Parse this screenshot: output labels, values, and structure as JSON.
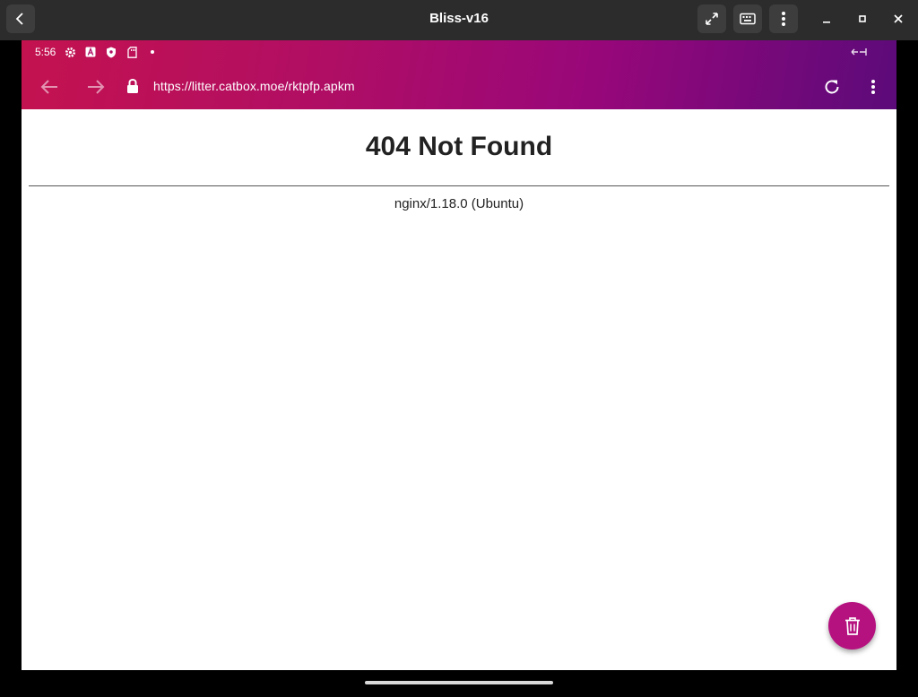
{
  "window": {
    "title": "Bliss-v16"
  },
  "status_bar": {
    "time": "5:56"
  },
  "browser": {
    "url": "https://litter.catbox.moe/rktpfp.apkm"
  },
  "page": {
    "heading": "404 Not Found",
    "server": "nginx/1.18.0 (Ubuntu)"
  },
  "icons": {
    "titlebar": [
      "back-icon",
      "expand-icon",
      "keyboard-icon",
      "more-vert-icon",
      "minimize-icon",
      "maximize-icon",
      "close-icon"
    ],
    "status": [
      "gear-icon",
      "a-letter-icon",
      "shield-icon",
      "sd-card-icon",
      "dot-icon",
      "link-icon"
    ],
    "browser": [
      "arrow-back-icon",
      "arrow-forward-icon",
      "lock-icon",
      "reload-icon",
      "overflow-menu-icon"
    ],
    "fab": "trash-icon"
  },
  "colors": {
    "titlebar_bg": "#2c2c2c",
    "appbar_gradient_start": "#c4124f",
    "appbar_gradient_end": "#5c0a7a",
    "fab": "#b5127f"
  }
}
